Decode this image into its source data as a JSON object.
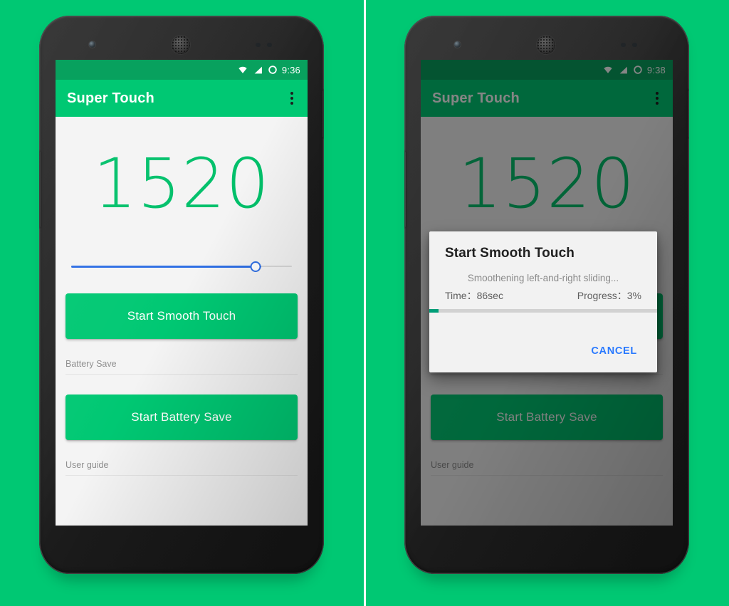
{
  "page": {
    "background_color": "#00c873",
    "divider_color": "#ffffff"
  },
  "theme": {
    "green": "#00c873",
    "green_dark": "#08a15e",
    "number_green": "#00c06a",
    "slider_blue": "#2f6fe4",
    "cancel_blue": "#2979ff",
    "progress_green": "#009e78",
    "screen_bg": "#f4f4f4",
    "dialog_bg": "#f2f2f2",
    "scrim": "rgba(0,0,0,0.48)"
  },
  "panels": [
    {
      "id": "left",
      "statusbar": {
        "time": "9:36",
        "icons": [
          "wifi-icon",
          "signal-icon",
          "ring-icon"
        ]
      },
      "appbar": {
        "title": "Super Touch",
        "overflow_label": "overflow-menu"
      },
      "main": {
        "counter_value": "1520",
        "slider": {
          "value_percent": 82,
          "min": 0,
          "max": 100
        },
        "primary_button": "Start Smooth Touch",
        "battery_section_label": "Battery Save",
        "secondary_button": "Start Battery Save",
        "guide_section_label": "User guide"
      },
      "navbar": {
        "back": "back-icon",
        "home": "home-icon",
        "recents": "recents-icon"
      },
      "dialog": null
    },
    {
      "id": "right",
      "statusbar": {
        "time": "9:38",
        "icons": [
          "wifi-icon",
          "signal-icon",
          "ring-icon"
        ]
      },
      "appbar": {
        "title": "Super Touch",
        "overflow_label": "overflow-menu"
      },
      "main": {
        "counter_value": "1520",
        "slider": {
          "value_percent": 82,
          "min": 0,
          "max": 100
        },
        "primary_button": "Start Smooth Touch",
        "battery_section_label": "Battery Save",
        "secondary_button": "Start Battery Save",
        "guide_section_label": "User guide"
      },
      "navbar": {
        "back": "back-icon",
        "home": "home-icon",
        "recents": "recents-icon"
      },
      "dialog": {
        "title": "Start Smooth Touch",
        "subtitle": "Smoothening left-and-right sliding...",
        "time_label": "Time：",
        "time_value": "86sec",
        "progress_label": "Progress：",
        "progress_value": "3%",
        "progress_percent": 3,
        "cancel_label": "CANCEL"
      }
    }
  ]
}
